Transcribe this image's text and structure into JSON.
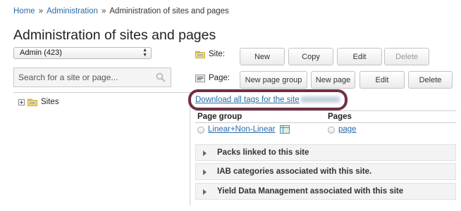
{
  "breadcrumb": {
    "home": "Home",
    "sep1": "»",
    "administration": "Administration",
    "sep2": "»",
    "current": "Administration of sites and pages"
  },
  "page_title": "Administration of sites and pages",
  "account_select": {
    "selected": "Admin (423)"
  },
  "search": {
    "placeholder": "Search for a site or page..."
  },
  "tree": {
    "root_label": "Sites"
  },
  "site_row": {
    "label": "Site:",
    "buttons": {
      "new": "New",
      "copy": "Copy",
      "edit": "Edit",
      "delete": "Delete"
    }
  },
  "page_row": {
    "label": "Page:",
    "buttons": {
      "new_page_group": "New page group",
      "new_page": "New page",
      "edit": "Edit",
      "delete": "Delete"
    }
  },
  "download_link": "Download all tags for the site",
  "table": {
    "headers": {
      "page_group": "Page group",
      "pages": "Pages"
    },
    "rows": [
      {
        "page_group": "Linear+Non-Linear",
        "page": "page"
      }
    ]
  },
  "sections": [
    {
      "label": "Packs linked to this site"
    },
    {
      "label": "IAB categories associated with this site."
    },
    {
      "label": "Yield Data Management associated with this site"
    }
  ],
  "colors": {
    "link": "#2a6aa8",
    "highlight_border": "#6f2f44"
  },
  "icons": {
    "search": "magnifier-icon",
    "expand": "plus-square-icon",
    "folder": "folder-icon",
    "site": "site-folder-icon",
    "page": "page-icon",
    "grid": "table-grid-icon",
    "collapse": "chevron-right-icon"
  }
}
